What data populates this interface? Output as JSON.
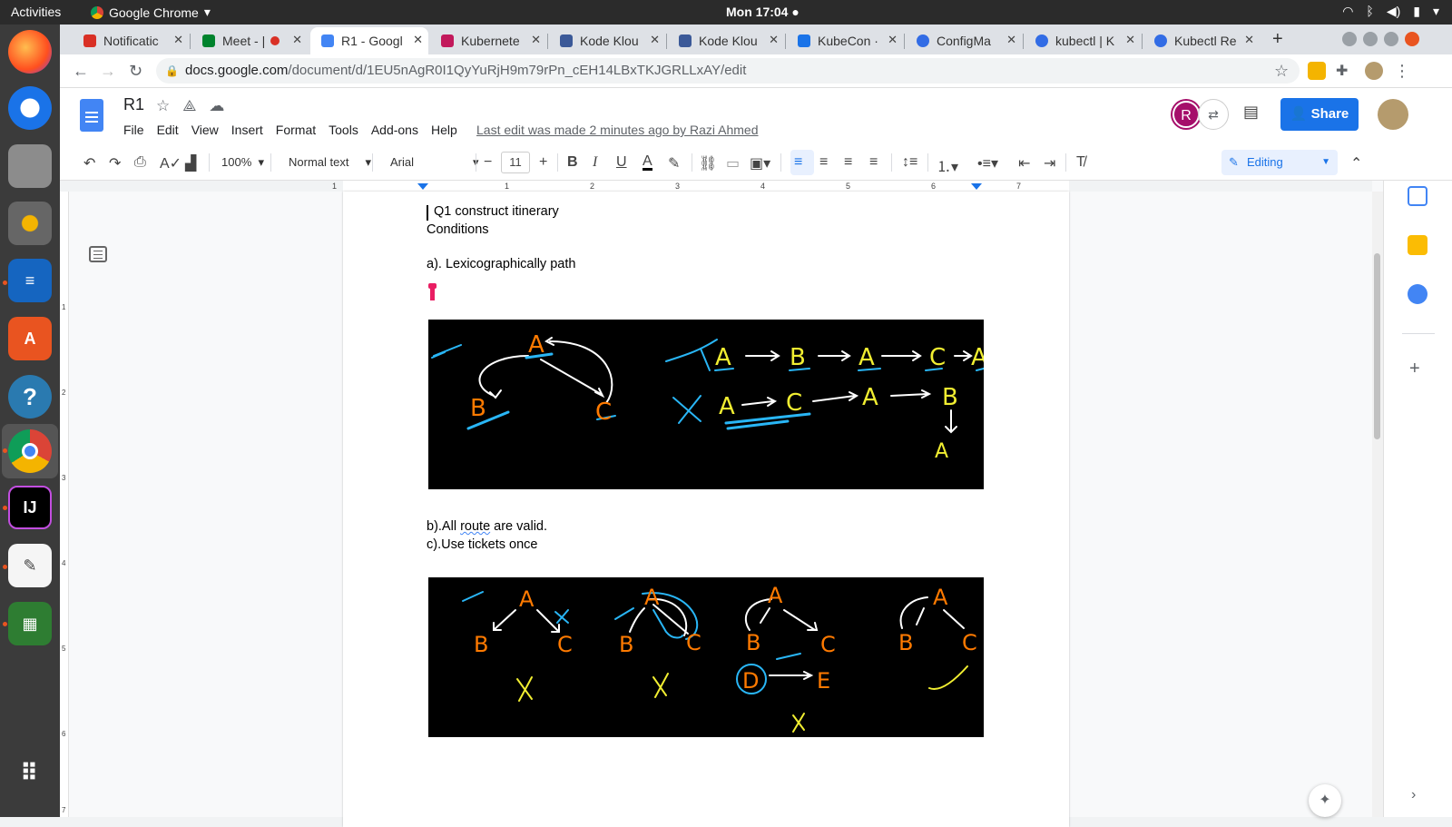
{
  "system": {
    "activities": "Activities",
    "app_name": "Google Chrome",
    "clock": "Mon 17:04"
  },
  "tabs": [
    {
      "label": "Notificatic",
      "color": "#d93025"
    },
    {
      "label": "Meet - |",
      "color": "#00832d"
    },
    {
      "label": "R1 - Googl",
      "color": "#4285f4"
    },
    {
      "label": "Kubernete",
      "color": "#c2185b"
    },
    {
      "label": "Kode Klou",
      "color": "#3b5998"
    },
    {
      "label": "Kode Klou",
      "color": "#3b5998"
    },
    {
      "label": "KubeCon ·",
      "color": "#1a73e8"
    },
    {
      "label": "ConfigMa",
      "color": "#326ce5"
    },
    {
      "label": "kubectl | K",
      "color": "#326ce5"
    },
    {
      "label": "Kubectl Re",
      "color": "#326ce5"
    }
  ],
  "address": {
    "host": "docs.google.com",
    "path": "/document/d/1EU5nAgR0I1QyYuRjH9m79rPn_cEH14LBxTKJGRLLxAY/edit"
  },
  "doc": {
    "title": "R1",
    "menus": [
      "File",
      "Edit",
      "View",
      "Insert",
      "Format",
      "Tools",
      "Add-ons",
      "Help"
    ],
    "last_edit": "Last edit was made 2 minutes ago by Razi Ahmed",
    "avatar_initial": "R",
    "share_label": "Share"
  },
  "toolbar": {
    "zoom": "100%",
    "style": "Normal text",
    "font": "Arial",
    "font_size": "11",
    "mode": "Editing"
  },
  "ruler_marks": [
    "1",
    "1",
    "2",
    "3",
    "4",
    "5",
    "6",
    "7"
  ],
  "vruler_marks": [
    "1",
    "2",
    "3",
    "4",
    "5",
    "6",
    "7"
  ],
  "content": {
    "line1": "Q1 construct itinerary",
    "line2": "Conditions",
    "line3": "a). Lexicographically path",
    "line4_pre": "b).All ",
    "line4_sq": "route",
    "line4_post": " are valid.",
    "line5": "c).Use tickets once"
  },
  "sketch1": {
    "graph": {
      "root": "A",
      "left": "B",
      "right": "C"
    },
    "path_good": [
      "A",
      "B",
      "A",
      "C",
      "A"
    ],
    "path_bad": [
      "A",
      "C",
      "A",
      "B",
      "A"
    ]
  },
  "sketch2": {
    "nodes": [
      "A",
      "B",
      "C",
      "A",
      "B",
      "C",
      "A",
      "B",
      "C",
      "A",
      "B",
      "C",
      "D",
      "E"
    ]
  }
}
